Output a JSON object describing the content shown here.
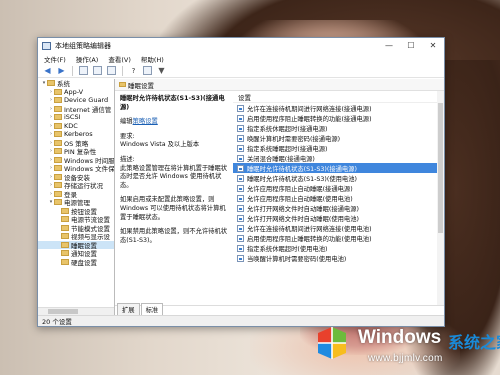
{
  "window": {
    "title": "本地组策略编辑器",
    "controls": [
      "—",
      "☐",
      "✕"
    ]
  },
  "menu": [
    "文件(F)",
    "操作(A)",
    "查看(V)",
    "帮助(H)"
  ],
  "tree": {
    "items": [
      {
        "label": "系统",
        "level": 0,
        "expanded": true
      },
      {
        "label": "App-V",
        "level": 1
      },
      {
        "label": "Device Guard",
        "level": 1
      },
      {
        "label": "Internet 通信管",
        "level": 1
      },
      {
        "label": "iSCSI",
        "level": 1
      },
      {
        "label": "KDC",
        "level": 1
      },
      {
        "label": "Kerberos",
        "level": 1
      },
      {
        "label": "OS 策略",
        "level": 1
      },
      {
        "label": "PIN 复杂性",
        "level": 1
      },
      {
        "label": "Windows 时间服",
        "level": 1
      },
      {
        "label": "Windows 文件保",
        "level": 1
      },
      {
        "label": "设备安装",
        "level": 1
      },
      {
        "label": "存储运行状况",
        "level": 1
      },
      {
        "label": "登录",
        "level": 1
      },
      {
        "label": "电源管理",
        "level": 1,
        "expanded": true
      },
      {
        "label": "按钮设置",
        "level": 2
      },
      {
        "label": "电源节流设置",
        "level": 2
      },
      {
        "label": "节能模式设置",
        "level": 2
      },
      {
        "label": "视频与显示设",
        "level": 2
      },
      {
        "label": "睡眠设置",
        "level": 2,
        "selected": true
      },
      {
        "label": "通知设置",
        "level": 2
      },
      {
        "label": "硬盘设置",
        "level": 2
      }
    ]
  },
  "breadcrumb": "睡眠设置",
  "description": {
    "title": "睡眠时允许待机状态(S1-S3)(接通电源)",
    "edit_prefix": "编辑",
    "edit_link": "策略设置",
    "req_label": "要求:",
    "req_value": "Windows Vista 及以上版本",
    "desc_label": "描述:",
    "desc_text": "此策略设置管理在将计算机置于睡眠状态时是否允许 Windows 使用待机状态。",
    "enable_text": "如果启用或未配置此策略设置，则 Windows 可以使用待机状态将计算机置于睡眠状态。",
    "disable_text": "如果禁用此策略设置，则不允许待机状态(S1-S3)。"
  },
  "list": {
    "header": "设置",
    "rows": [
      {
        "label": "允许在连接待机期间进行网络连接(接通电源)"
      },
      {
        "label": "启用使用程序阻止睡眠转换的功能(接通电源)"
      },
      {
        "label": "指定系统休眠超时(接通电源)"
      },
      {
        "label": "唤醒计算机时需要密码(接通电源)"
      },
      {
        "label": "指定系统睡眠超时(接通电源)"
      },
      {
        "label": "关闭混合睡眠(接通电源)"
      },
      {
        "label": "睡眠时允许待机状态(S1-S3)(接通电源)",
        "selected": true
      },
      {
        "label": "睡眠时允许待机状态(S1-S3)(使用电池)"
      },
      {
        "label": "允许应用程序阻止自动睡眠(接通电源)"
      },
      {
        "label": "允许应用程序阻止自动睡眠(使用电池)"
      },
      {
        "label": "允许打开网络文件时自动睡眠(接通电源)"
      },
      {
        "label": "允许打开网络文件时自动睡眠(使用电池)"
      },
      {
        "label": "允许在连接待机期间进行网络连接(使用电池)"
      },
      {
        "label": "启用使用程序阻止睡眠转换的功能(使用电池)"
      },
      {
        "label": "指定系统休眠超时(使用电池)"
      },
      {
        "label": "当唤醒计算机时需要密码(使用电池)"
      }
    ]
  },
  "tabs": [
    "扩展",
    "标准"
  ],
  "status": "20 个设置",
  "watermark": {
    "brand": "Windows",
    "cn": "系统之家",
    "url": "www.bjjmlv.com",
    "colors": {
      "red": "#e8412c",
      "green": "#6cbb3c",
      "blue": "#1f8ae0",
      "yellow": "#f7bd1e"
    }
  }
}
